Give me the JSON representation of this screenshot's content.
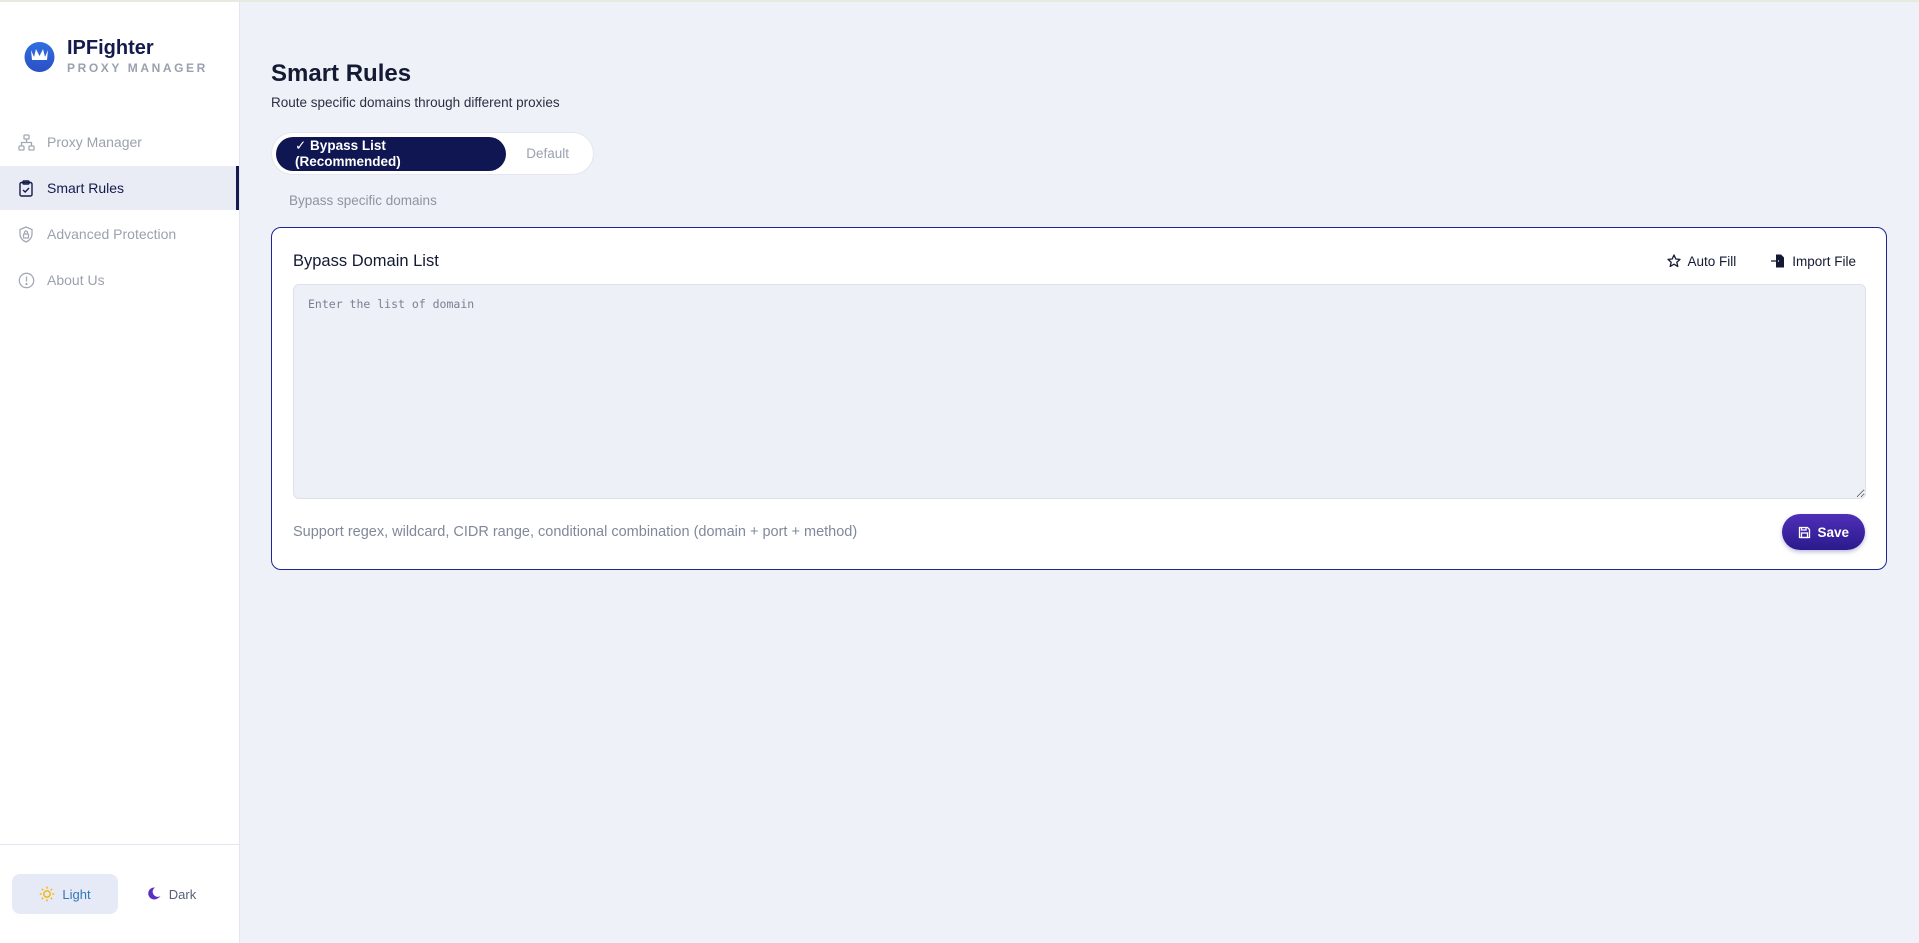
{
  "brand": {
    "name": "IPFighter",
    "subtitle": "PROXY MANAGER",
    "accent_color": "#141a4d"
  },
  "sidebar": {
    "items": [
      {
        "label": "Proxy Manager",
        "icon": "network-icon",
        "active": false
      },
      {
        "label": "Smart Rules",
        "icon": "clipboard-check-icon",
        "active": true
      },
      {
        "label": "Advanced Protection",
        "icon": "shield-lock-icon",
        "active": false
      },
      {
        "label": "About Us",
        "icon": "info-icon",
        "active": false
      }
    ],
    "theme": {
      "light_label": "Light",
      "dark_label": "Dark",
      "selected": "Light"
    }
  },
  "page": {
    "title": "Smart Rules",
    "subtitle": "Route specific domains through different proxies"
  },
  "mode": {
    "options": [
      {
        "label": "✓ Bypass List (Recommended)",
        "active": true
      },
      {
        "label": "Default",
        "active": false
      }
    ],
    "hint": "Bypass specific domains"
  },
  "card": {
    "title": "Bypass Domain List",
    "auto_fill_label": "Auto Fill",
    "import_file_label": "Import File",
    "input_placeholder": "Enter the list of domain",
    "input_value": "",
    "support_text": "Support regex, wildcard, CIDR range, conditional combination (domain + port + method)",
    "save_label": "Save",
    "border_color": "#1e2690",
    "save_color": "#3a22a2"
  }
}
